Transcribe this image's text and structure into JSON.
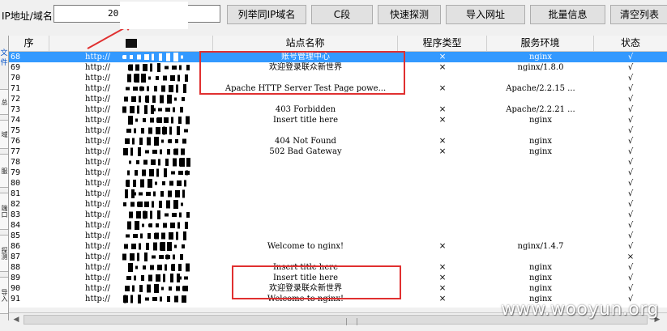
{
  "toolbar": {
    "label": "IP地址/域名",
    "input_value": "20",
    "buttons": [
      "列举同IP域名",
      "C段",
      "快速探测",
      "导入网址",
      "批量信息",
      "清空列表"
    ]
  },
  "sidebar": {
    "icons": [
      "文",
      "件"
    ],
    "tabs": [
      "总",
      "域",
      "服",
      "端口",
      "探测",
      "导入"
    ]
  },
  "table": {
    "headers": [
      "序",
      "",
      "站点名称",
      "程序类型",
      "服务环境",
      "状态"
    ],
    "rows": [
      {
        "idx": "68",
        "url": "http://",
        "title": "账号管理中心",
        "type": "×",
        "server": "nginx",
        "status": "√",
        "selected": true
      },
      {
        "idx": "69",
        "url": "http://",
        "title": "欢迎登录联众新世界",
        "type": "×",
        "server": "nginx/1.8.0",
        "status": "√"
      },
      {
        "idx": "70",
        "url": "http://",
        "title": "",
        "type": "",
        "server": "",
        "status": "√"
      },
      {
        "idx": "71",
        "url": "http://",
        "title": "Apache HTTP Server Test Page powe...",
        "type": "×",
        "server": "Apache/2.2.15 ...",
        "status": "√"
      },
      {
        "idx": "72",
        "url": "http://",
        "title": "",
        "type": "",
        "server": "",
        "status": "√"
      },
      {
        "idx": "73",
        "url": "http://",
        "title": "403 Forbidden",
        "type": "×",
        "server": "Apache/2.2.21 ...",
        "status": "√"
      },
      {
        "idx": "74",
        "url": "http://",
        "title": "Insert title here",
        "type": "×",
        "server": "nginx",
        "status": "√"
      },
      {
        "idx": "75",
        "url": "http://",
        "title": "",
        "type": "",
        "server": "",
        "status": "√"
      },
      {
        "idx": "76",
        "url": "http://",
        "title": "404 Not Found",
        "type": "×",
        "server": "nginx",
        "status": "√"
      },
      {
        "idx": "77",
        "url": "http://",
        "title": "502 Bad Gateway",
        "type": "×",
        "server": "nginx",
        "status": "√"
      },
      {
        "idx": "78",
        "url": "http://",
        "title": "",
        "type": "",
        "server": "",
        "status": "√"
      },
      {
        "idx": "79",
        "url": "http://",
        "title": "",
        "type": "",
        "server": "",
        "status": "√"
      },
      {
        "idx": "80",
        "url": "http://",
        "title": "",
        "type": "",
        "server": "",
        "status": "√"
      },
      {
        "idx": "81",
        "url": "http://",
        "title": "",
        "type": "",
        "server": "",
        "status": "√"
      },
      {
        "idx": "82",
        "url": "http://",
        "title": "",
        "type": "",
        "server": "",
        "status": "√"
      },
      {
        "idx": "83",
        "url": "http://",
        "title": "",
        "type": "",
        "server": "",
        "status": "√"
      },
      {
        "idx": "84",
        "url": "http://",
        "title": "",
        "type": "",
        "server": "",
        "status": "√"
      },
      {
        "idx": "85",
        "url": "http://",
        "title": "",
        "type": "",
        "server": "",
        "status": "√"
      },
      {
        "idx": "86",
        "url": "http://",
        "title": "Welcome to nginx!",
        "type": "×",
        "server": "nginx/1.4.7",
        "status": "√"
      },
      {
        "idx": "87",
        "url": "http://",
        "title": "",
        "type": "",
        "server": "",
        "status": "×"
      },
      {
        "idx": "88",
        "url": "http://",
        "title": "Insert title here",
        "type": "×",
        "server": "nginx",
        "status": "√"
      },
      {
        "idx": "89",
        "url": "http://",
        "title": "Insert title here",
        "type": "×",
        "server": "nginx",
        "status": "√"
      },
      {
        "idx": "90",
        "url": "http://",
        "title": "欢迎登录联众新世界",
        "type": "×",
        "server": "nginx",
        "status": "√"
      },
      {
        "idx": "91",
        "url": "http://",
        "title": "Welcome to nginx!",
        "type": "×",
        "server": "nginx",
        "status": "√"
      }
    ]
  },
  "watermark": "www.wooyun.org",
  "colors": {
    "selection": "#3399ff",
    "highlight_box": "#e03030",
    "arrow": "#e03030"
  }
}
